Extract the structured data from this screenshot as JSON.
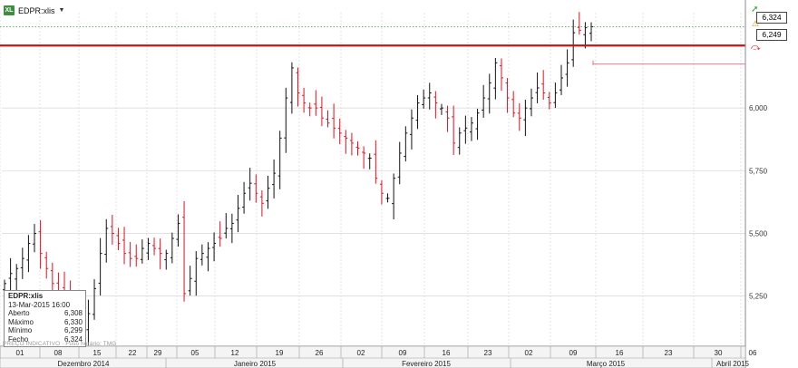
{
  "header": {
    "symbol": "EDPR:xlis",
    "dropdown_icon": "chevron-down-icon",
    "logo_icon": "spreadsheet-icon"
  },
  "price_boxes": {
    "last": "6,324",
    "line": "6,249"
  },
  "side_icons": {
    "trend_up": "trend-up-icon",
    "alert": "alert-icon",
    "signal": "signal-icon"
  },
  "info_panel": {
    "title": "EDPR:xlis",
    "date": "13-Mar-2015 16:00",
    "rows": [
      {
        "label": "Aberto",
        "value": "6,308"
      },
      {
        "label": "Máximo",
        "value": "6,330"
      },
      {
        "label": "Mínimo",
        "value": "6,299"
      },
      {
        "label": "Fecho",
        "value": "6,324"
      }
    ]
  },
  "footer_note": "PREÇO INDICATIVO · Fuso horário: TMG",
  "colors": {
    "up": "#111111",
    "down": "#e01020",
    "resistance": "#cc1111",
    "grid": "#d7d7d7",
    "last_line": "#3a9a3a"
  },
  "chart_data": {
    "type": "ohlc",
    "x_unit": "trading day (daily bars, 28-Nov-2014 to 13-Mar-2015)",
    "ylim": [
      5.05,
      6.38
    ],
    "y_ticks": [
      "5,250",
      "5,500",
      "5,750",
      "6,000"
    ],
    "y_tick_values": [
      5.25,
      5.5,
      5.75,
      6.0
    ],
    "week_labels": [
      "01",
      "08",
      "15",
      "22",
      "29",
      "05",
      "12",
      "19",
      "26",
      "02",
      "09",
      "16",
      "23",
      "02",
      "09",
      "16",
      "23",
      "30",
      "06"
    ],
    "month_labels": [
      "Dezembro 2014",
      "Janeiro 2015",
      "Fevereiro 2015",
      "Março 2015",
      "Abril 2015"
    ],
    "resistance_level": 6.249,
    "last_price": 6.324,
    "reference_level": 6.175,
    "closes": [
      5.3,
      5.34,
      5.36,
      5.4,
      5.46,
      5.5,
      5.42,
      5.36,
      5.3,
      5.26,
      5.24,
      5.2,
      5.12,
      5.1,
      5.18,
      5.28,
      5.42,
      5.52,
      5.5,
      5.46,
      5.42,
      5.4,
      5.4,
      5.44,
      5.46,
      5.44,
      5.42,
      5.42,
      5.48,
      5.54,
      5.26,
      5.32,
      5.4,
      5.42,
      5.44,
      5.46,
      5.48,
      5.52,
      5.54,
      5.6,
      5.66,
      5.7,
      5.66,
      5.62,
      5.68,
      5.74,
      5.88,
      6.04,
      6.16,
      6.06,
      6.02,
      6.0,
      6.0,
      5.96,
      5.94,
      5.92,
      5.9,
      5.88,
      5.86,
      5.84,
      5.82,
      5.8,
      5.72,
      5.66,
      5.64,
      5.72,
      5.82,
      5.9,
      5.96,
      6.02,
      6.04,
      6.06,
      6.02,
      6.0,
      5.96,
      5.86,
      5.9,
      5.92,
      5.94,
      5.98,
      6.04,
      6.1,
      6.18,
      6.12,
      6.04,
      5.98,
      5.96,
      6.0,
      6.04,
      6.08,
      6.06,
      6.02,
      6.06,
      6.12,
      6.18,
      6.3,
      6.31,
      6.32,
      6.324
    ]
  }
}
